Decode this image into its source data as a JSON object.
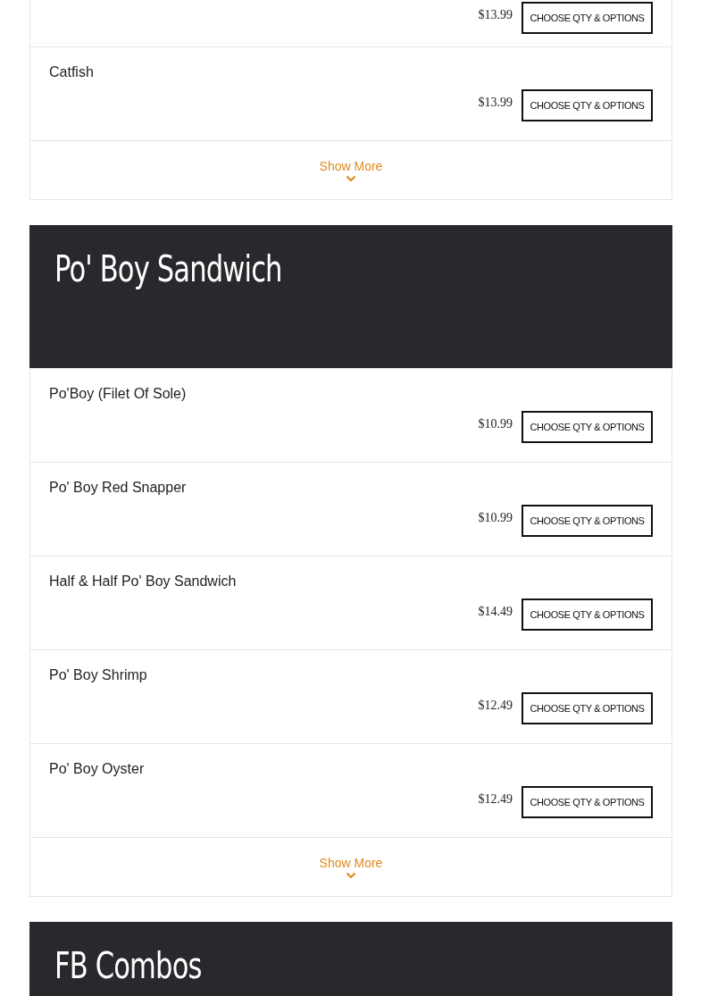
{
  "sections": [
    {
      "items": [
        {
          "price": "$13.99",
          "button": "CHOOSE QTY & OPTIONS"
        },
        {
          "name": "Catfish",
          "price": "$13.99",
          "button": "CHOOSE QTY & OPTIONS"
        }
      ],
      "show_more": "Show More"
    },
    {
      "title": "Po' Boy Sandwich",
      "items": [
        {
          "name": "Po'Boy (Filet Of Sole)",
          "price": "$10.99",
          "button": "CHOOSE QTY & OPTIONS"
        },
        {
          "name": "Po' Boy Red Snapper",
          "price": "$10.99",
          "button": "CHOOSE QTY & OPTIONS"
        },
        {
          "name": "Half & Half Po' Boy Sandwich",
          "price": "$14.49",
          "button": "CHOOSE QTY & OPTIONS"
        },
        {
          "name": "Po' Boy Shrimp",
          "price": "$12.49",
          "button": "CHOOSE QTY & OPTIONS"
        },
        {
          "name": "Po' Boy Oyster",
          "price": "$12.49",
          "button": "CHOOSE QTY & OPTIONS"
        }
      ],
      "show_more": "Show More"
    },
    {
      "title": "FB Combos"
    }
  ]
}
